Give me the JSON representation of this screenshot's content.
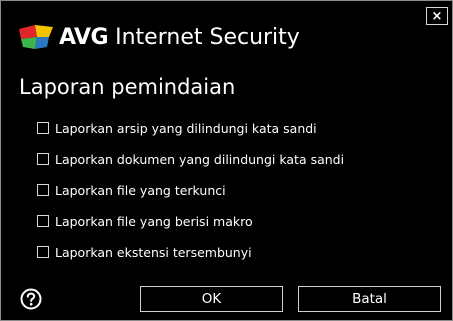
{
  "window": {
    "brand_name": "AVG",
    "product_name": "Internet Security",
    "close_label": "×"
  },
  "dialog": {
    "heading": "Laporan pemindaian",
    "options": [
      {
        "label": "Laporkan arsip yang dilindungi kata sandi",
        "checked": false
      },
      {
        "label": "Laporkan dokumen yang dilindungi kata sandi",
        "checked": false
      },
      {
        "label": "Laporkan file yang terkunci",
        "checked": false
      },
      {
        "label": "Laporkan file yang berisi makro",
        "checked": false
      },
      {
        "label": "Laporkan ekstensi tersembunyi",
        "checked": false
      }
    ]
  },
  "footer": {
    "help_icon": "help-circle-icon",
    "ok_label": "OK",
    "cancel_label": "Batal"
  },
  "colors": {
    "background": "#000000",
    "text": "#ffffff",
    "logo_red": "#e3262b",
    "logo_yellow": "#f5c400",
    "logo_green": "#3bb54a",
    "logo_blue": "#2a78c4"
  }
}
